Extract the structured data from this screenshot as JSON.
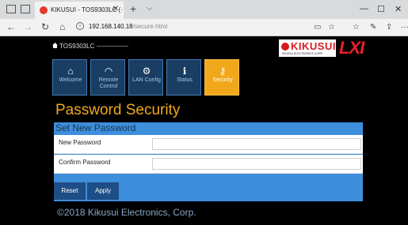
{
  "browser": {
    "tab_title": "KIKUSUI - TOS9303LC (·",
    "tab_close": "✕",
    "new_tab": "+",
    "tab_dropdown": "⌵",
    "url_host": "192.168.140.18",
    "url_path": "/secure.html",
    "nav_back": "←",
    "nav_forward": "→",
    "nav_reload": "↻",
    "nav_home": "⌂",
    "win_min": "—",
    "win_max": "☐",
    "win_close": "✕",
    "tool_reader": "▭",
    "tool_favorite": "☆",
    "tool_favorites": "☆",
    "tool_pen": "✎",
    "tool_share": "⇪",
    "tool_more": "···"
  },
  "header": {
    "home_label": "TOS9303LC",
    "brand_name": "KIKUSUI",
    "brand_sub": "KIKUSUI ELECTRONICS CORP.",
    "lxi_logo": "LXI"
  },
  "nav": [
    {
      "label": "Welcome",
      "icon": "home-icon",
      "glyph": "⌂"
    },
    {
      "label": "Remote Control",
      "icon": "gauge-icon",
      "glyph": "◠"
    },
    {
      "label": "LAN Config",
      "icon": "gear-icon",
      "glyph": "⚙"
    },
    {
      "label": "Status",
      "icon": "info-icon",
      "glyph": "ℹ"
    },
    {
      "label": "Security",
      "icon": "key-icon",
      "glyph": "⚷"
    }
  ],
  "page": {
    "title": "Password Security",
    "section_title": "Set New Password",
    "fields": {
      "new_password_label": "New Password",
      "new_password_value": "",
      "confirm_password_label": "Confirm Password",
      "confirm_password_value": ""
    },
    "buttons": {
      "reset": "Reset",
      "apply": "Apply"
    },
    "footer": "©2018 Kikusui Electronics, Corp."
  },
  "colors": {
    "accent_orange": "#f0a81a",
    "panel_blue": "#3d8fdc",
    "nav_blue": "#1a3d63",
    "brand_red": "#d71920"
  }
}
